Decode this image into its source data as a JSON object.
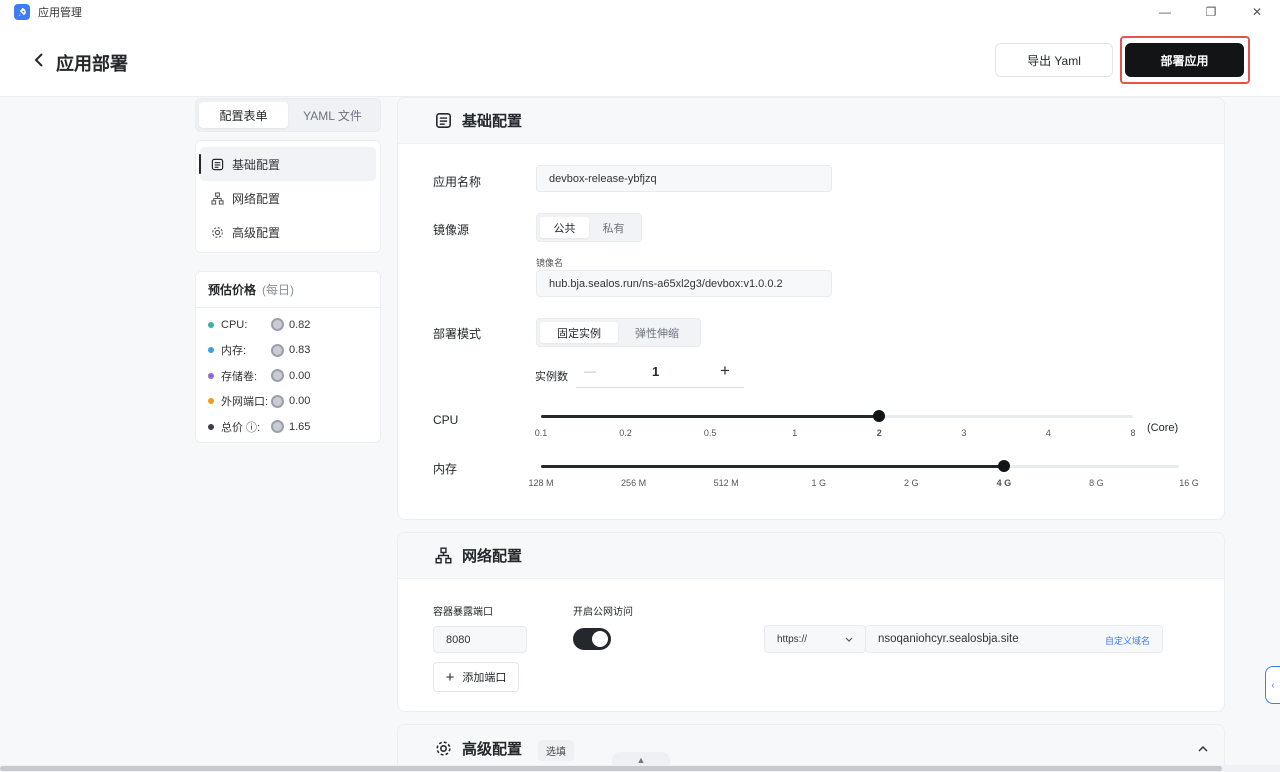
{
  "window": {
    "title": "应用管理",
    "minimize_glyph": "—",
    "restore_glyph": "❐",
    "close_glyph": "✕"
  },
  "header": {
    "title": "应用部署",
    "export_label": "导出 Yaml",
    "deploy_label": "部署应用"
  },
  "sidebar": {
    "tabs": [
      {
        "label": "配置表单",
        "active": true
      },
      {
        "label": "YAML 文件",
        "active": false
      }
    ],
    "nav": [
      {
        "label": "基础配置",
        "icon": "document-icon",
        "active": true
      },
      {
        "label": "网络配置",
        "icon": "network-icon",
        "active": false
      },
      {
        "label": "高级配置",
        "icon": "gear-icon",
        "active": false
      }
    ],
    "price": {
      "title": "预估价格",
      "subtitle": "(每日)",
      "rows": [
        {
          "label": "CPU:",
          "value": "0.82",
          "color": "#33b5a8"
        },
        {
          "label": "内存:",
          "value": "0.83",
          "color": "#3aa0e0"
        },
        {
          "label": "存储卷:",
          "value": "0.00",
          "color": "#8d6bd6"
        },
        {
          "label": "外网端口:",
          "value": "0.00",
          "color": "#f29b1b"
        },
        {
          "label": "总价 ⓘ:",
          "value": "1.65",
          "color": "#3a3f47"
        }
      ]
    }
  },
  "basic": {
    "title": "基础配置",
    "app_name_label": "应用名称",
    "app_name_value": "devbox-release-ybfjzq",
    "image_source_label": "镜像源",
    "image_source_options": [
      {
        "label": "公共",
        "active": true
      },
      {
        "label": "私有",
        "active": false
      }
    ],
    "image_name_label": "镜像名",
    "image_name_value": "hub.bja.sealos.run/ns-a65xl2g3/devbox:v1.0.0.2",
    "deploy_mode_label": "部署模式",
    "deploy_mode_options": [
      {
        "label": "固定实例",
        "active": true
      },
      {
        "label": "弹性伸缩",
        "active": false
      }
    ],
    "replicas_label": "实例数",
    "replicas_value": "1",
    "minus": "—",
    "plus": "+",
    "cpu_label": "CPU",
    "cpu_ticks": [
      "0.1",
      "0.2",
      "0.5",
      "1",
      "2",
      "3",
      "4",
      "8"
    ],
    "cpu_value_index": 4,
    "cpu_unit": "(Core)",
    "memory_label": "内存",
    "memory_ticks": [
      "128 M",
      "256 M",
      "512 M",
      "1 G",
      "2 G",
      "4 G",
      "8 G",
      "16 G"
    ],
    "memory_value_index": 5
  },
  "network": {
    "title": "网络配置",
    "port_label": "容器暴露端口",
    "port_value": "8080",
    "public_label": "开启公网访问",
    "public_enabled": true,
    "protocol": "https://",
    "domain": "nsoqaniohcyr.sealosbja.site",
    "custom_domain": "自定义域名",
    "add_port": "添加端口"
  },
  "advanced": {
    "title": "高级配置",
    "badge": "选填"
  }
}
